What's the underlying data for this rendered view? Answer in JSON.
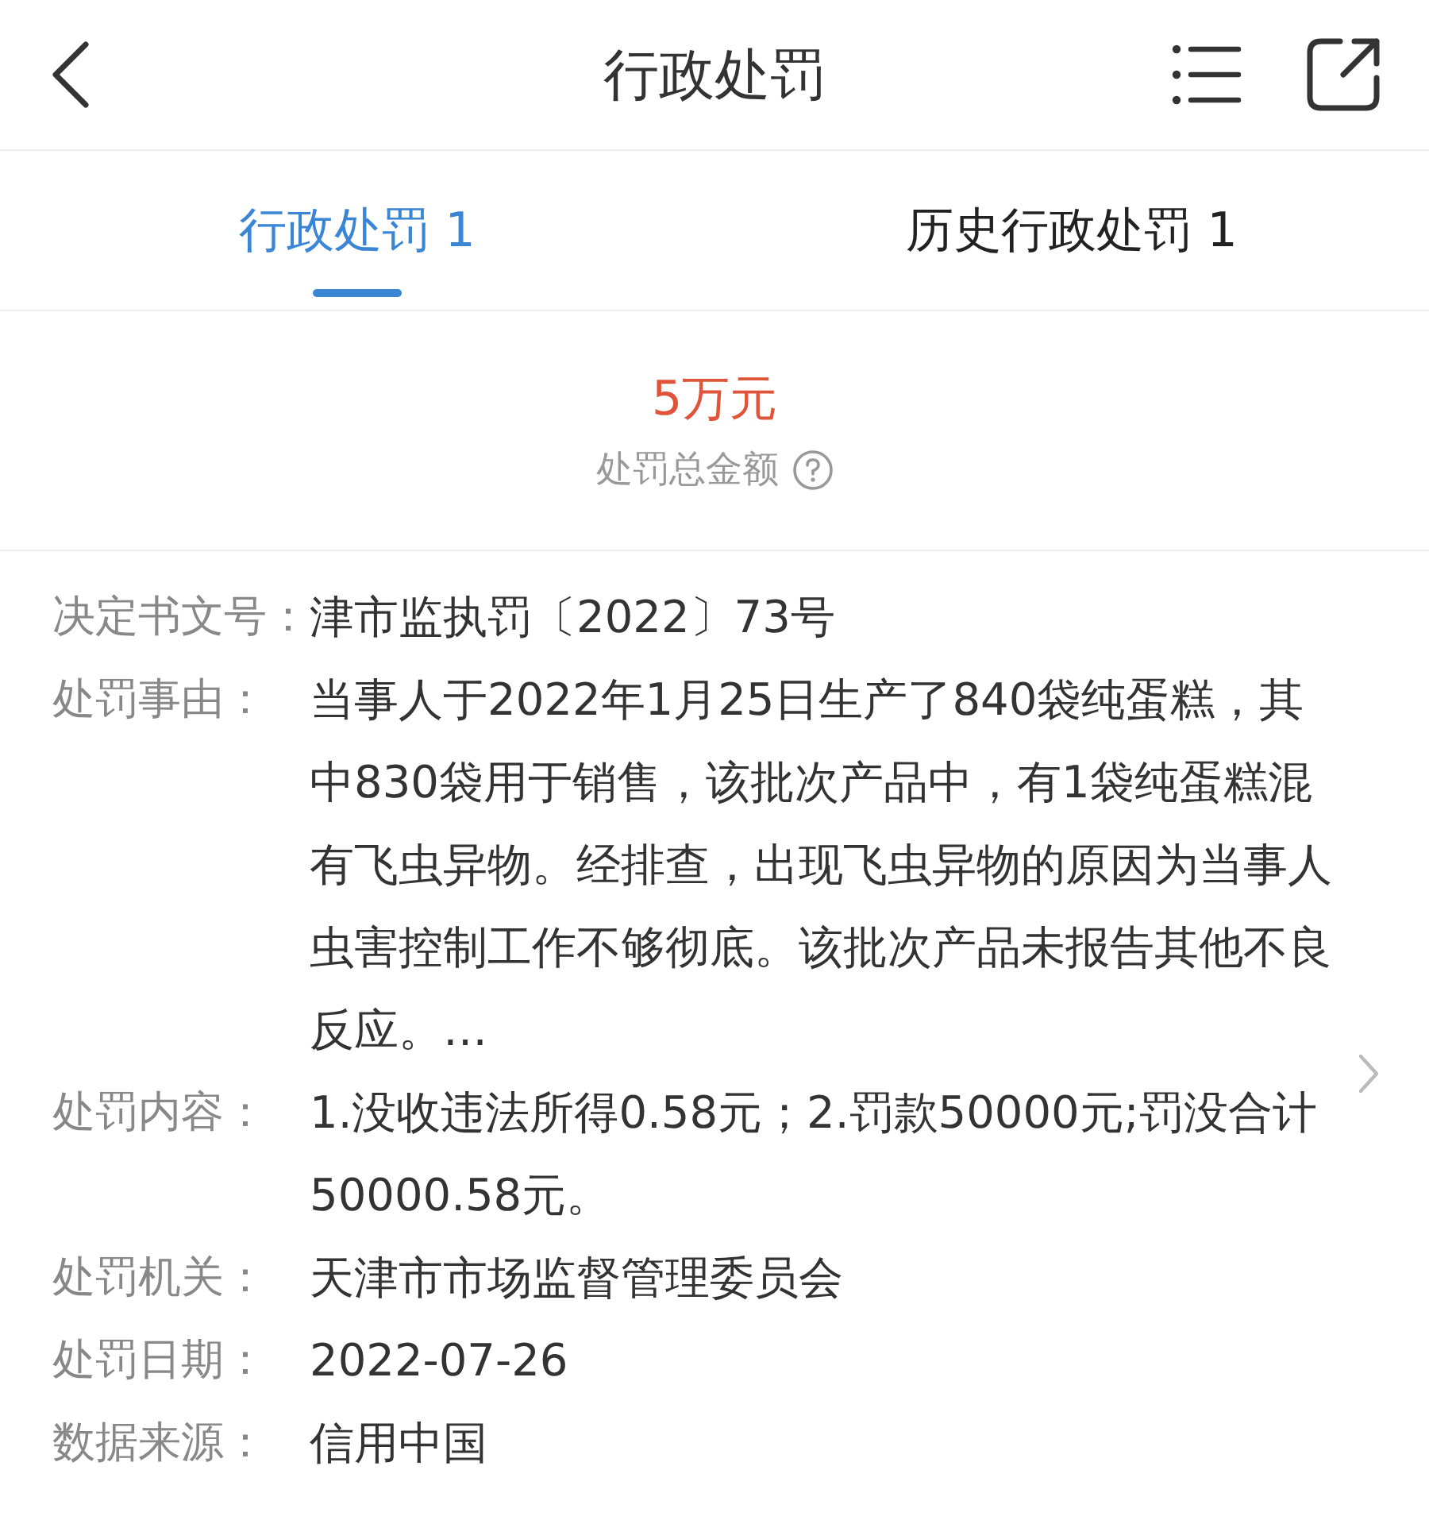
{
  "header": {
    "title": "行政处罚"
  },
  "tabs": [
    {
      "label": "行政处罚 1",
      "selected": true
    },
    {
      "label": "历史行政处罚 1",
      "selected": false
    }
  ],
  "summary": {
    "amount": "5万元",
    "caption": "处罚总金额"
  },
  "details": [
    {
      "label": "决定书文号：",
      "value": "津市监执罚〔2022〕73号"
    },
    {
      "label": "处罚事由：",
      "value": "当事人于2022年1月25日生产了840袋纯蛋糕，其中830袋用于销售，该批次产品中，有1袋纯蛋糕混有飞虫异物。经排查，出现飞虫异物的原因为当事人虫害控制工作不够彻底。该批次产品未报告其他不良反应。…",
      "expandable": true
    },
    {
      "label": "处罚内容：",
      "value": "1.没收违法所得0.58元；2.罚款50000元;罚没合计50000.58元。"
    },
    {
      "label": "处罚机关：",
      "value": "天津市市场监督管理委员会"
    },
    {
      "label": "处罚日期：",
      "value": "2022-07-26"
    },
    {
      "label": "数据来源：",
      "value": "信用中国"
    }
  ]
}
